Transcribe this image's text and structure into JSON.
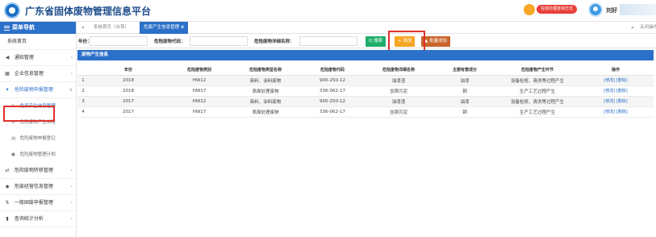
{
  "header": {
    "title": "广东省固体废物管理信息平台",
    "chat_badge": "在线办理咨询方式",
    "user_name": "刘好"
  },
  "sidebar": {
    "title": "菜单导航",
    "items": [
      {
        "label": "系统首页",
        "icon": "home"
      },
      {
        "label": "通知管理",
        "icon": "megaphone-icon",
        "chevron": "‹"
      },
      {
        "label": "企业信息管理",
        "icon": "grid-icon",
        "chevron": "‹"
      },
      {
        "label": "危险废物申报管理",
        "icon": "recycle-icon",
        "chevron": "∨"
      },
      {
        "label": "危险废物转移管理",
        "icon": "truck-icon",
        "chevron": "‹"
      },
      {
        "label": "危废经营信息管理",
        "icon": "tag-icon",
        "chevron": "‹"
      },
      {
        "label": "一般固废申报管理",
        "icon": "sliders-icon",
        "chevron": "‹"
      },
      {
        "label": "查询统计分析",
        "icon": "chart-icon",
        "chevron": "‹"
      }
    ],
    "sub_items": [
      {
        "label": "危废产生信息管理",
        "icon": "edit-icon"
      },
      {
        "label": "危险废物产生台账",
        "icon": "list-icon"
      },
      {
        "label": "危险废物申报登记",
        "icon": "book-icon"
      },
      {
        "label": "危险废物管理计划",
        "icon": "disk-icon"
      }
    ]
  },
  "tabs": {
    "prev": "«",
    "items": [
      {
        "label": "系统首页（台首）"
      },
      {
        "label": "危废产生信息管理 ⊗"
      }
    ],
    "next": "»",
    "actions": "关闭操作 ▾"
  },
  "search": {
    "year_label": "年份：",
    "code_label": "危险废物代码：",
    "name_label": "危险废物详细名称：",
    "search_btn": "Q 搜索",
    "add_btn": "+ 添加",
    "batch_btn": "▲ 批量添加"
  },
  "panel": {
    "title": "废物产生信息"
  },
  "table": {
    "headers": [
      "",
      "年份",
      "危险废物类别",
      "危险废物类型名称",
      "危险废物代码",
      "危险废物详细名称",
      "主要有害成分",
      "危险废物产生环节",
      "操作"
    ],
    "rows": [
      [
        "1",
        "2018",
        "HW12",
        "染料、涂料废物",
        "900-250-12",
        "油漆渣",
        "油漆",
        "设备检修、清洗等过程产生",
        "[修改] [删除]"
      ],
      [
        "2",
        "2018",
        "HW17",
        "表面处理废物",
        "336-062-17",
        "含铜污泥",
        "铜",
        "生产工艺过程产生",
        "[修改] [删除]"
      ],
      [
        "3",
        "2017",
        "HW12",
        "染料、涂料废物",
        "900-250-12",
        "油漆渣",
        "油漆",
        "设备检修、清洗等过程产生",
        "[修改] [删除]"
      ],
      [
        "4",
        "2017",
        "HW17",
        "表面处理废物",
        "336-062-17",
        "含铜污泥",
        "铜",
        "生产工艺过程产生",
        "[修改] [删除]"
      ]
    ]
  },
  "colors": {
    "primary": "#2b70c9",
    "highlight": "#e1302a",
    "search": "#1eae6a",
    "add": "#f5a623",
    "batch": "#c9652a"
  }
}
